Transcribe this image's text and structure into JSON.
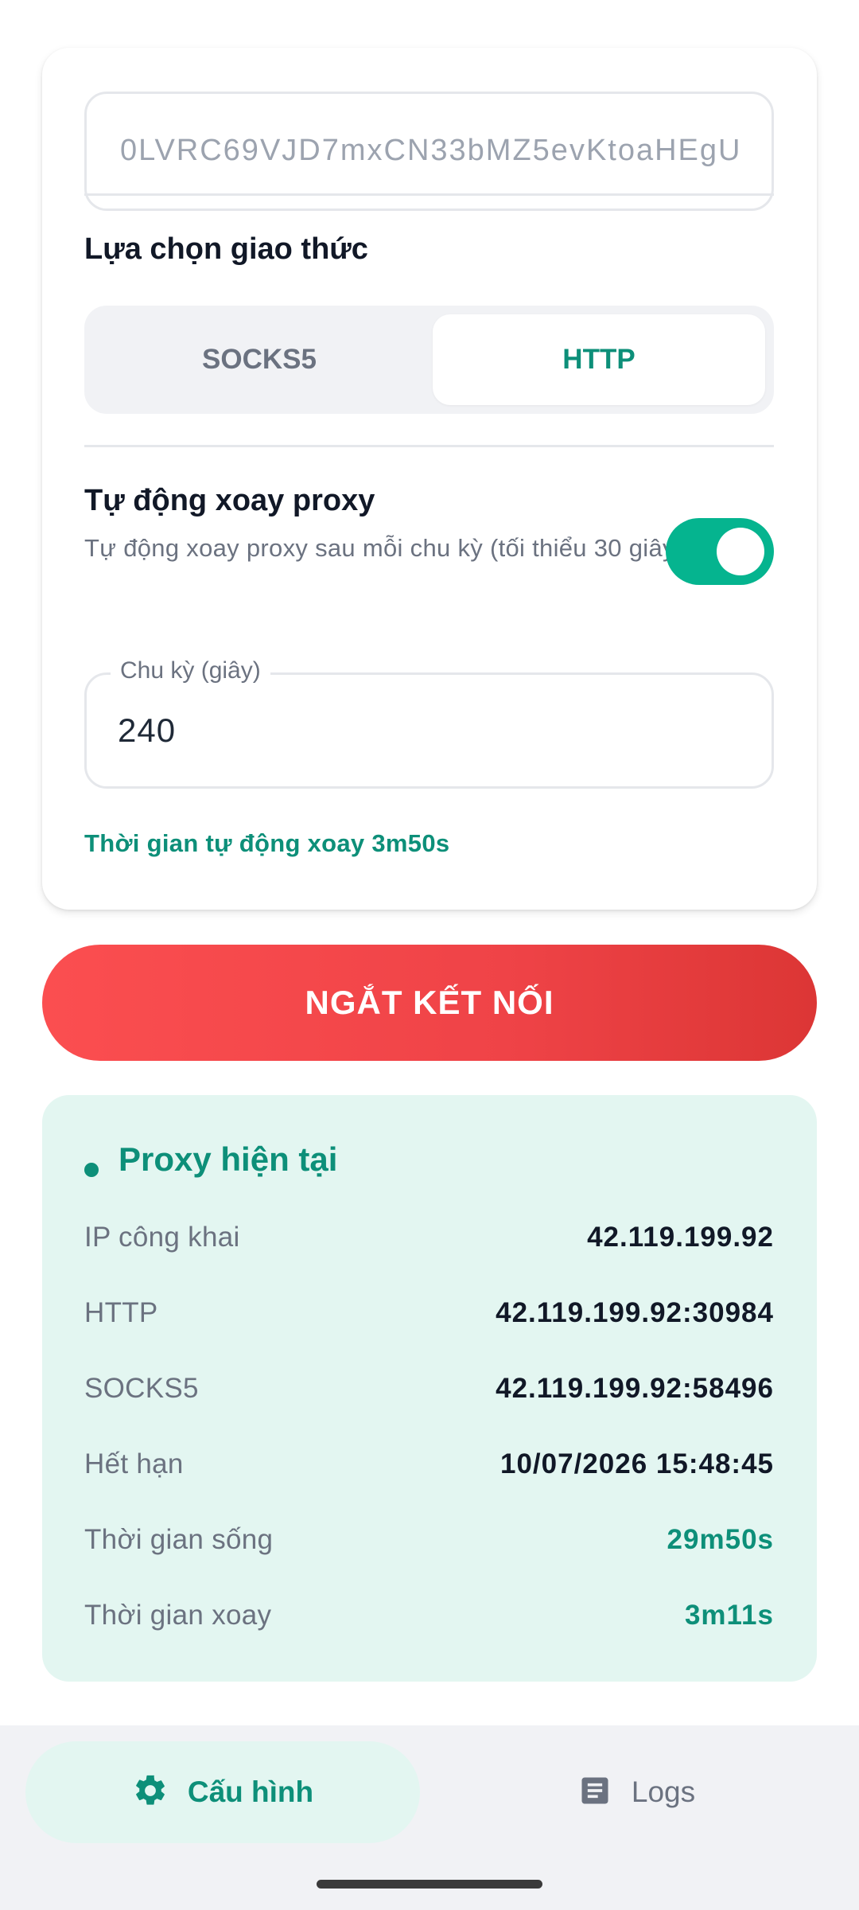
{
  "settings": {
    "api_key_partial": "0LVRC69VJD7mxCN33bMZ5evKtoaHEgU",
    "protocol_title": "Lựa chọn giao thức",
    "protocol_options": [
      "SOCKS5",
      "HTTP"
    ],
    "protocol_selected": "HTTP",
    "auto_rotate_title": "Tự động xoay proxy",
    "auto_rotate_desc": "Tự động xoay proxy sau mỗi chu kỳ (tối thiểu 30 giây)",
    "auto_rotate_enabled": true,
    "period_label": "Chu kỳ (giây)",
    "period_value": "240",
    "auto_rotate_timer": "Thời gian tự động xoay 3m50s"
  },
  "disconnect_label": "NGẮT KẾT NỐI",
  "proxy": {
    "title": "Proxy hiện tại",
    "rows": [
      {
        "label": "IP công khai",
        "value": "42.119.199.92",
        "highlight": false
      },
      {
        "label": "HTTP",
        "value": "42.119.199.92:30984",
        "highlight": false
      },
      {
        "label": "SOCKS5",
        "value": "42.119.199.92:58496",
        "highlight": false
      },
      {
        "label": "Hết hạn",
        "value": "10/07/2026 15:48:45",
        "highlight": false
      },
      {
        "label": "Thời gian sống",
        "value": "29m50s",
        "highlight": true
      },
      {
        "label": "Thời gian xoay",
        "value": "3m11s",
        "highlight": true
      }
    ]
  },
  "nav": {
    "config_label": "Cấu hình",
    "config_icon": "gear-icon",
    "logs_label": "Logs",
    "logs_icon": "document-icon",
    "active": "config"
  },
  "colors": {
    "accent": "#0d8f79",
    "toggle_on": "#05b48f",
    "danger": "#ef4347",
    "panel_bg": "#e3f6f1"
  }
}
